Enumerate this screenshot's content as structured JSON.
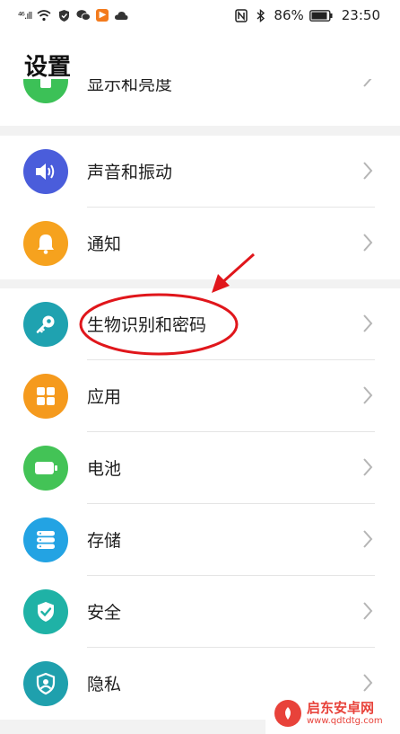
{
  "status_bar": {
    "left_signal_text": "⁴⁶.ıll",
    "battery_percent": "86%",
    "time": "23:50",
    "icons_left": [
      "signal-icon",
      "wifi-icon",
      "shield-icon",
      "wechat-icon",
      "app-badge-icon",
      "cloud-icon"
    ],
    "icons_right": [
      "nfc-icon",
      "bluetooth-icon",
      "battery-icon"
    ]
  },
  "header": {
    "title": "设置"
  },
  "partial_item": {
    "label": "显示和亮度",
    "icon": "display-icon",
    "color": "#3cc157"
  },
  "groups": [
    {
      "items": [
        {
          "label": "声音和振动",
          "icon": "sound-icon",
          "color": "#4a5ddb"
        },
        {
          "label": "通知",
          "icon": "bell-icon",
          "color": "#f6a21e"
        }
      ]
    },
    {
      "items": [
        {
          "label": "生物识别和密码",
          "icon": "key-icon",
          "color": "#1fa2b0"
        },
        {
          "label": "应用",
          "icon": "apps-icon",
          "color": "#f59a1d"
        },
        {
          "label": "电池",
          "icon": "battery-setting-icon",
          "color": "#43c356"
        },
        {
          "label": "存储",
          "icon": "storage-icon",
          "color": "#23a3e3"
        },
        {
          "label": "安全",
          "icon": "security-shield-icon",
          "color": "#1fb2a6"
        },
        {
          "label": "隐私",
          "icon": "privacy-icon",
          "color": "#1fa0ad"
        }
      ]
    }
  ],
  "annotation": {
    "color": "#e0161b"
  },
  "watermark": {
    "main": "启东安卓网",
    "sub": "www.qdtdtg.com"
  }
}
